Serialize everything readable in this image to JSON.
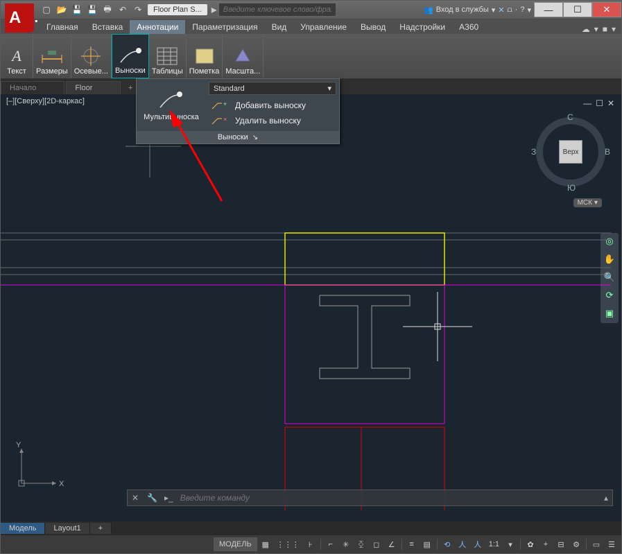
{
  "app": {
    "letter": "A"
  },
  "titlebar": {
    "doc_title": "Floor Plan S...",
    "search_placeholder": "Введите ключевое слово/фразу",
    "signin": "Вход в службы"
  },
  "sys": {
    "min": "—",
    "max": "☐",
    "close": "✕"
  },
  "tabs": {
    "items": [
      "Главная",
      "Вставка",
      "Аннотации",
      "Параметризация",
      "Вид",
      "Управление",
      "Вывод",
      "Надстройки",
      "A360"
    ]
  },
  "panels": {
    "text": "Текст",
    "dims": "Размеры",
    "axes": "Осевые...",
    "leaders": "Выноски",
    "tables": "Таблицы",
    "markup": "Пометка",
    "scale": "Масшта..."
  },
  "drawtabs": {
    "start": "Начало",
    "current": "Floor",
    "plus": "+"
  },
  "viewport": {
    "label": "[–][Сверху][2D-каркас]",
    "ctrl_min": "—",
    "ctrl_max": "☐",
    "ctrl_close": "✕"
  },
  "viewcube": {
    "top": "С",
    "right": "В",
    "bottom": "Ю",
    "left": "З",
    "face": "Верх"
  },
  "ucs_badge": "МСК",
  "ucs": {
    "x": "X",
    "y": "Y"
  },
  "dropdown": {
    "left_label": "Мультивыноска",
    "style": "Standard",
    "add": "Добавить выноску",
    "remove": "Удалить выноску",
    "footer": "Выноски"
  },
  "cmd": {
    "placeholder": "Введите команду"
  },
  "modeltabs": {
    "model": "Модель",
    "layout": "Layout1",
    "plus": "+"
  },
  "status": {
    "model": "МОДЕЛЬ",
    "scale": "1:1"
  }
}
